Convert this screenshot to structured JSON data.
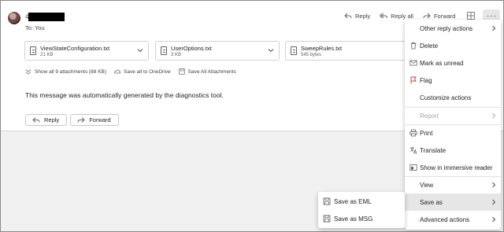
{
  "message": {
    "sender_prefix": "4",
    "to_line": "To: You",
    "body": "This message was automatically generated by the diagnostics tool."
  },
  "top_actions": {
    "reply": "Reply",
    "reply_all": "Reply all",
    "forward": "Forward",
    "more": "···"
  },
  "attachments": [
    {
      "name": "ViewStateConfiguration.txt",
      "size": "21 KB"
    },
    {
      "name": "UserOptions.txt",
      "size": "3 KB"
    },
    {
      "name": "SweepRules.txt",
      "size": "545 bytes"
    }
  ],
  "attachment_actions": {
    "show_all": "Show all 9 attachments (88 KB)",
    "save_onedrive": "Save all to OneDrive",
    "save_all": "Save All Attachments"
  },
  "bottom_buttons": {
    "reply": "Reply",
    "forward": "Forward"
  },
  "menu": {
    "items": [
      {
        "label": "Other reply actions"
      },
      {
        "label": "Delete"
      },
      {
        "label": "Mark as unread"
      },
      {
        "label": "Flag"
      },
      {
        "label": "Customize actions"
      },
      {
        "label": "Report"
      },
      {
        "label": "Print"
      },
      {
        "label": "Translate"
      },
      {
        "label": "Show in immersive reader"
      },
      {
        "label": "View"
      },
      {
        "label": "Save as"
      },
      {
        "label": "Advanced actions"
      }
    ]
  },
  "submenu": {
    "items": [
      {
        "label": "Save as EML"
      },
      {
        "label": "Save as MSG"
      }
    ]
  },
  "colors": {
    "flag": "#d13438",
    "hover": "#e6e6e6"
  }
}
